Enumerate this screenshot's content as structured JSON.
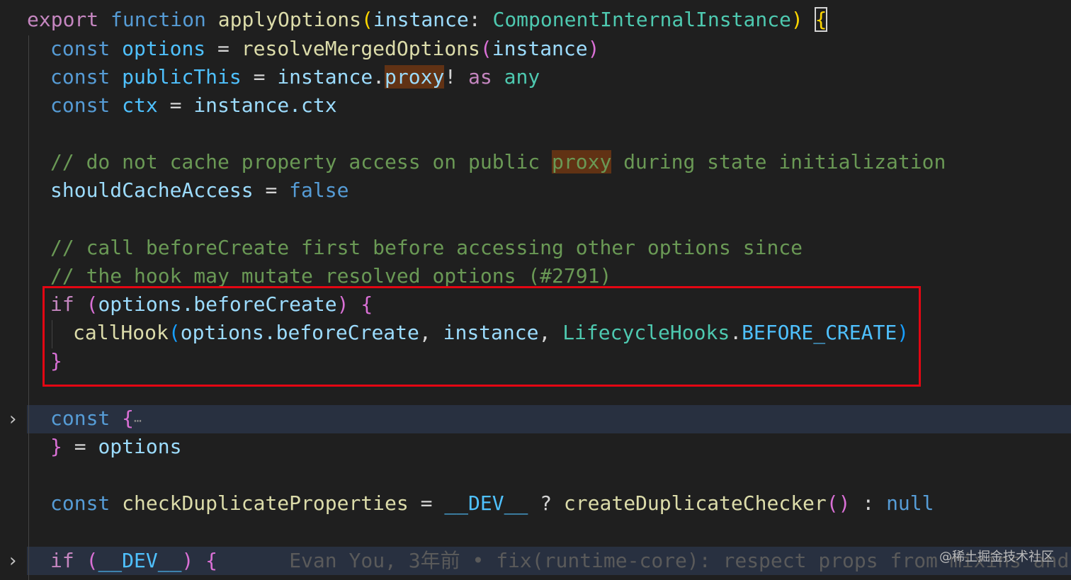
{
  "code": {
    "l1": {
      "export": "export",
      "function": "function",
      "name": "applyOptions",
      "param": "instance",
      "colon": ":",
      "type": "ComponentInternalInstance",
      "open": "(",
      "close": ")",
      "brace": "{"
    },
    "l2": {
      "const": "const",
      "var": "options",
      "eq": "=",
      "fn": "resolveMergedOptions",
      "arg": "instance"
    },
    "l3": {
      "const": "const",
      "var": "publicThis",
      "eq": "=",
      "obj": "instance",
      "dot": ".",
      "prop": "proxy",
      "bang": "!",
      "as": "as",
      "any": "any"
    },
    "l4": {
      "const": "const",
      "var": "ctx",
      "eq": "=",
      "obj": "instance",
      "prop": ".ctx"
    },
    "l6": {
      "comment_before": "// do not cache property access on public ",
      "comment_hl": "proxy",
      "comment_after": " during state initialization"
    },
    "l7": {
      "var": "shouldCacheAccess",
      "eq": "=",
      "val": "false"
    },
    "l9": {
      "comment": "// call beforeCreate first before accessing other options since"
    },
    "l10": {
      "comment": "// the hook may mutate resolved options (#2791)"
    },
    "l11": {
      "if": "if",
      "obj": "options",
      "prop": ".beforeCreate"
    },
    "l12": {
      "fn": "callHook",
      "a1": "options",
      "a1prop": ".beforeCreate",
      "a2": "instance",
      "a3": "LifecycleHooks",
      "a3prop": ".BEFORE_CREATE"
    },
    "l13": {
      "brace": "}"
    },
    "l15": {
      "const": "const",
      "brace": "{",
      "ellipsis": "⋯"
    },
    "l16": {
      "brace": "}",
      "eq": "=",
      "var": "options"
    },
    "l18": {
      "const": "const",
      "var": "checkDuplicateProperties",
      "eq": "=",
      "dev": "__DEV__",
      "q": "?",
      "fn": "createDuplicateChecker",
      "colon": ":",
      "null": "null"
    },
    "l20": {
      "if": "if",
      "dev": "__DEV__",
      "brace": "{",
      "blame": "Evan You, 3年前 • fix(runtime-core): respect props from mixins and …"
    }
  },
  "watermark": "@稀土掘金技术社区",
  "fold_icon": "chevron-right-icon"
}
